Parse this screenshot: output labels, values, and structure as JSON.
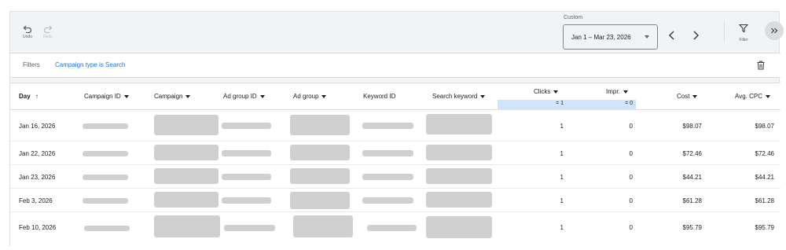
{
  "toolbar": {
    "undo_label": "Undo",
    "redo_label": "Redo",
    "date_range_label": "Custom",
    "date_range_value": "Jan 1 – Mar 23, 2026",
    "filter_label": "Filter"
  },
  "filters": {
    "label": "Filters",
    "active_filter": "Campaign type is Search"
  },
  "table": {
    "headers": {
      "day": "Day",
      "campaign_id": "Campaign ID",
      "campaign": "Campaign",
      "ad_group_id": "Ad group ID",
      "ad_group": "Ad group",
      "keyword_id": "Keyword ID",
      "search_keyword": "Search keyword",
      "clicks": "Clicks",
      "impr": "Impr.",
      "cost": "Cost",
      "avg_cpc": "Avg. CPC"
    },
    "totals": {
      "clicks": "= 1",
      "impr": "= 0"
    },
    "rows": [
      {
        "day": "Jan 16, 2026",
        "clicks": "1",
        "impr": "0",
        "cost": "$98.07",
        "avg_cpc": "$98.07"
      },
      {
        "day": "Jan 22, 2026",
        "clicks": "1",
        "impr": "0",
        "cost": "$72.46",
        "avg_cpc": "$72.46"
      },
      {
        "day": "Jan 23, 2026",
        "clicks": "1",
        "impr": "0",
        "cost": "$44.21",
        "avg_cpc": "$44.21"
      },
      {
        "day": "Feb 3, 2026",
        "clicks": "1",
        "impr": "0",
        "cost": "$61.28",
        "avg_cpc": "$61.28"
      },
      {
        "day": "Feb 10, 2026",
        "clicks": "1",
        "impr": "0",
        "cost": "$95.79",
        "avg_cpc": "$95.79"
      }
    ]
  },
  "colors": {
    "accent": "#1a73e8",
    "totals_band": "#d2e3fc",
    "redacted": "#d0d0d0"
  }
}
